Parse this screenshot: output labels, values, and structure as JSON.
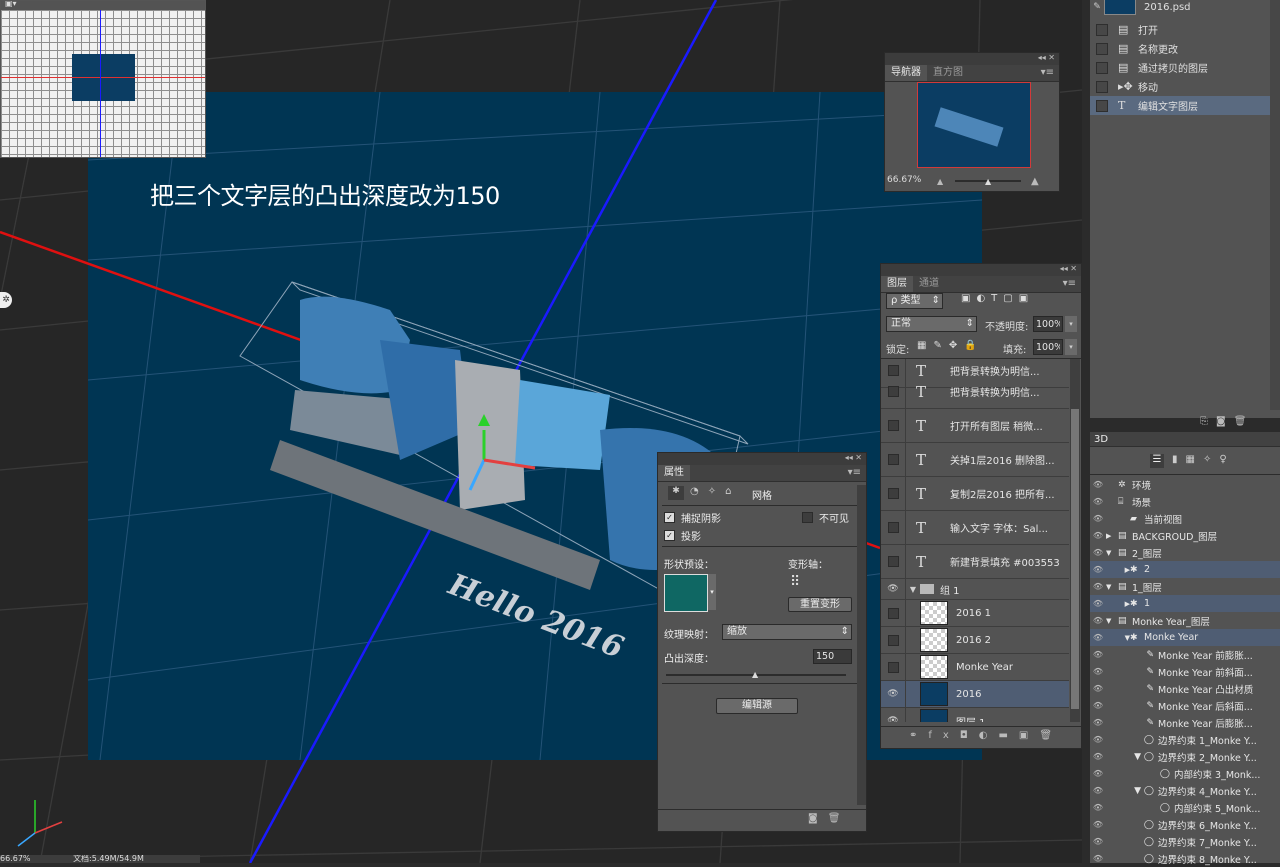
{
  "document": {
    "caption": "把三个文字层的凸出深度改为150",
    "object_text": "Hello 2016",
    "status_zoom": "66.67%",
    "status_doc": "文档:5.49M/54.9M"
  },
  "colors": {
    "canvas_bg": "#003553",
    "axis_red": "#e01010",
    "axis_blue": "#1a1aff",
    "selection_blue": "#4f5d73"
  },
  "navigator": {
    "tabs": [
      "导航器",
      "直方图"
    ],
    "zoom": "66.67%"
  },
  "layers_panel": {
    "tabs": [
      "图层",
      "通道"
    ],
    "filter_label": "ρ 类型",
    "blend_mode": "正常",
    "opacity_label": "不透明度:",
    "opacity_value": "100%",
    "lock_label": "锁定:",
    "fill_label": "填充:",
    "fill_value": "100%",
    "rows": [
      {
        "type": "text",
        "name": "把背景转换为明信..."
      },
      {
        "type": "text",
        "name": "打开所有图层 稍微..."
      },
      {
        "type": "text",
        "name": "关掉1层2016 删除图..."
      },
      {
        "type": "text",
        "name": "复制2层2016 把所有..."
      },
      {
        "type": "text",
        "name": "输入文字 字体：Sal..."
      },
      {
        "type": "text",
        "name": "新建背景填充 #003553"
      },
      {
        "type": "group",
        "name": "组 1"
      },
      {
        "type": "layer",
        "name": "2016 1"
      },
      {
        "type": "layer",
        "name": "2016 2"
      },
      {
        "type": "layer",
        "name": "Monke Year"
      },
      {
        "type": "layer3d",
        "name": "2016"
      },
      {
        "type": "fill",
        "name": "图层 1"
      }
    ]
  },
  "properties": {
    "title": "属性",
    "tab_mesh": "网格",
    "catch_shadow": "捕捉阴影",
    "invisible": "不可见",
    "cast_shadow": "投影",
    "shape_preset_label": "形状预设：",
    "deform_axis_label": "变形轴：",
    "reset_deform": "重置变形",
    "texture_map_label": "纹理映射：",
    "texture_map_value": "缩放",
    "extrusion_label": "凸出深度：",
    "extrusion_value": "150",
    "extrusion_fraction": 0.5,
    "edit_source": "编辑源"
  },
  "history": {
    "doc_name": "2016.psd",
    "items": [
      "打开",
      "名称更改",
      "通过拷贝的图层",
      "移动",
      "编辑文字图层"
    ]
  },
  "panel3d": {
    "title": "3D",
    "items": [
      "环境",
      "场景",
      "当前视图",
      "BACKGROUD_图层",
      "2_图层",
      "2",
      "1_图层",
      "1",
      "Monke Year_图层",
      "Monke Year",
      "Monke Year 前膨胀...",
      "Monke Year 前斜面...",
      "Monke Year 凸出材质",
      "Monke Year 后斜面...",
      "Monke Year 后膨胀...",
      "边界约束 1_Monke Y...",
      "边界约束 2_Monke Y...",
      "内部约束 3_Monk...",
      "边界约束 4_Monke Y...",
      "内部约束 5_Monk...",
      "边界约束 6_Monke Y...",
      "边界约束 7_Monke Y...",
      "边界约束 8_Monke Y..."
    ]
  }
}
